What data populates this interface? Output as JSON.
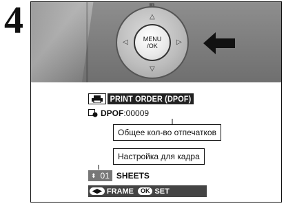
{
  "step": {
    "number": "4"
  },
  "camera": {
    "button_label_line1": "MENU",
    "button_label_line2": "/OK"
  },
  "screen": {
    "title": "PRINT ORDER (DPOF)",
    "dpof_label": "DPOF",
    "dpof_value": ":00009",
    "callout_total": "Общее кол-во отпечатков",
    "callout_frame": "Настройка для кадра",
    "sheets_count": "01",
    "sheets_label": "SHEETS",
    "frame_label": "FRAME",
    "ok_label": "OK",
    "set_label": "SET"
  }
}
